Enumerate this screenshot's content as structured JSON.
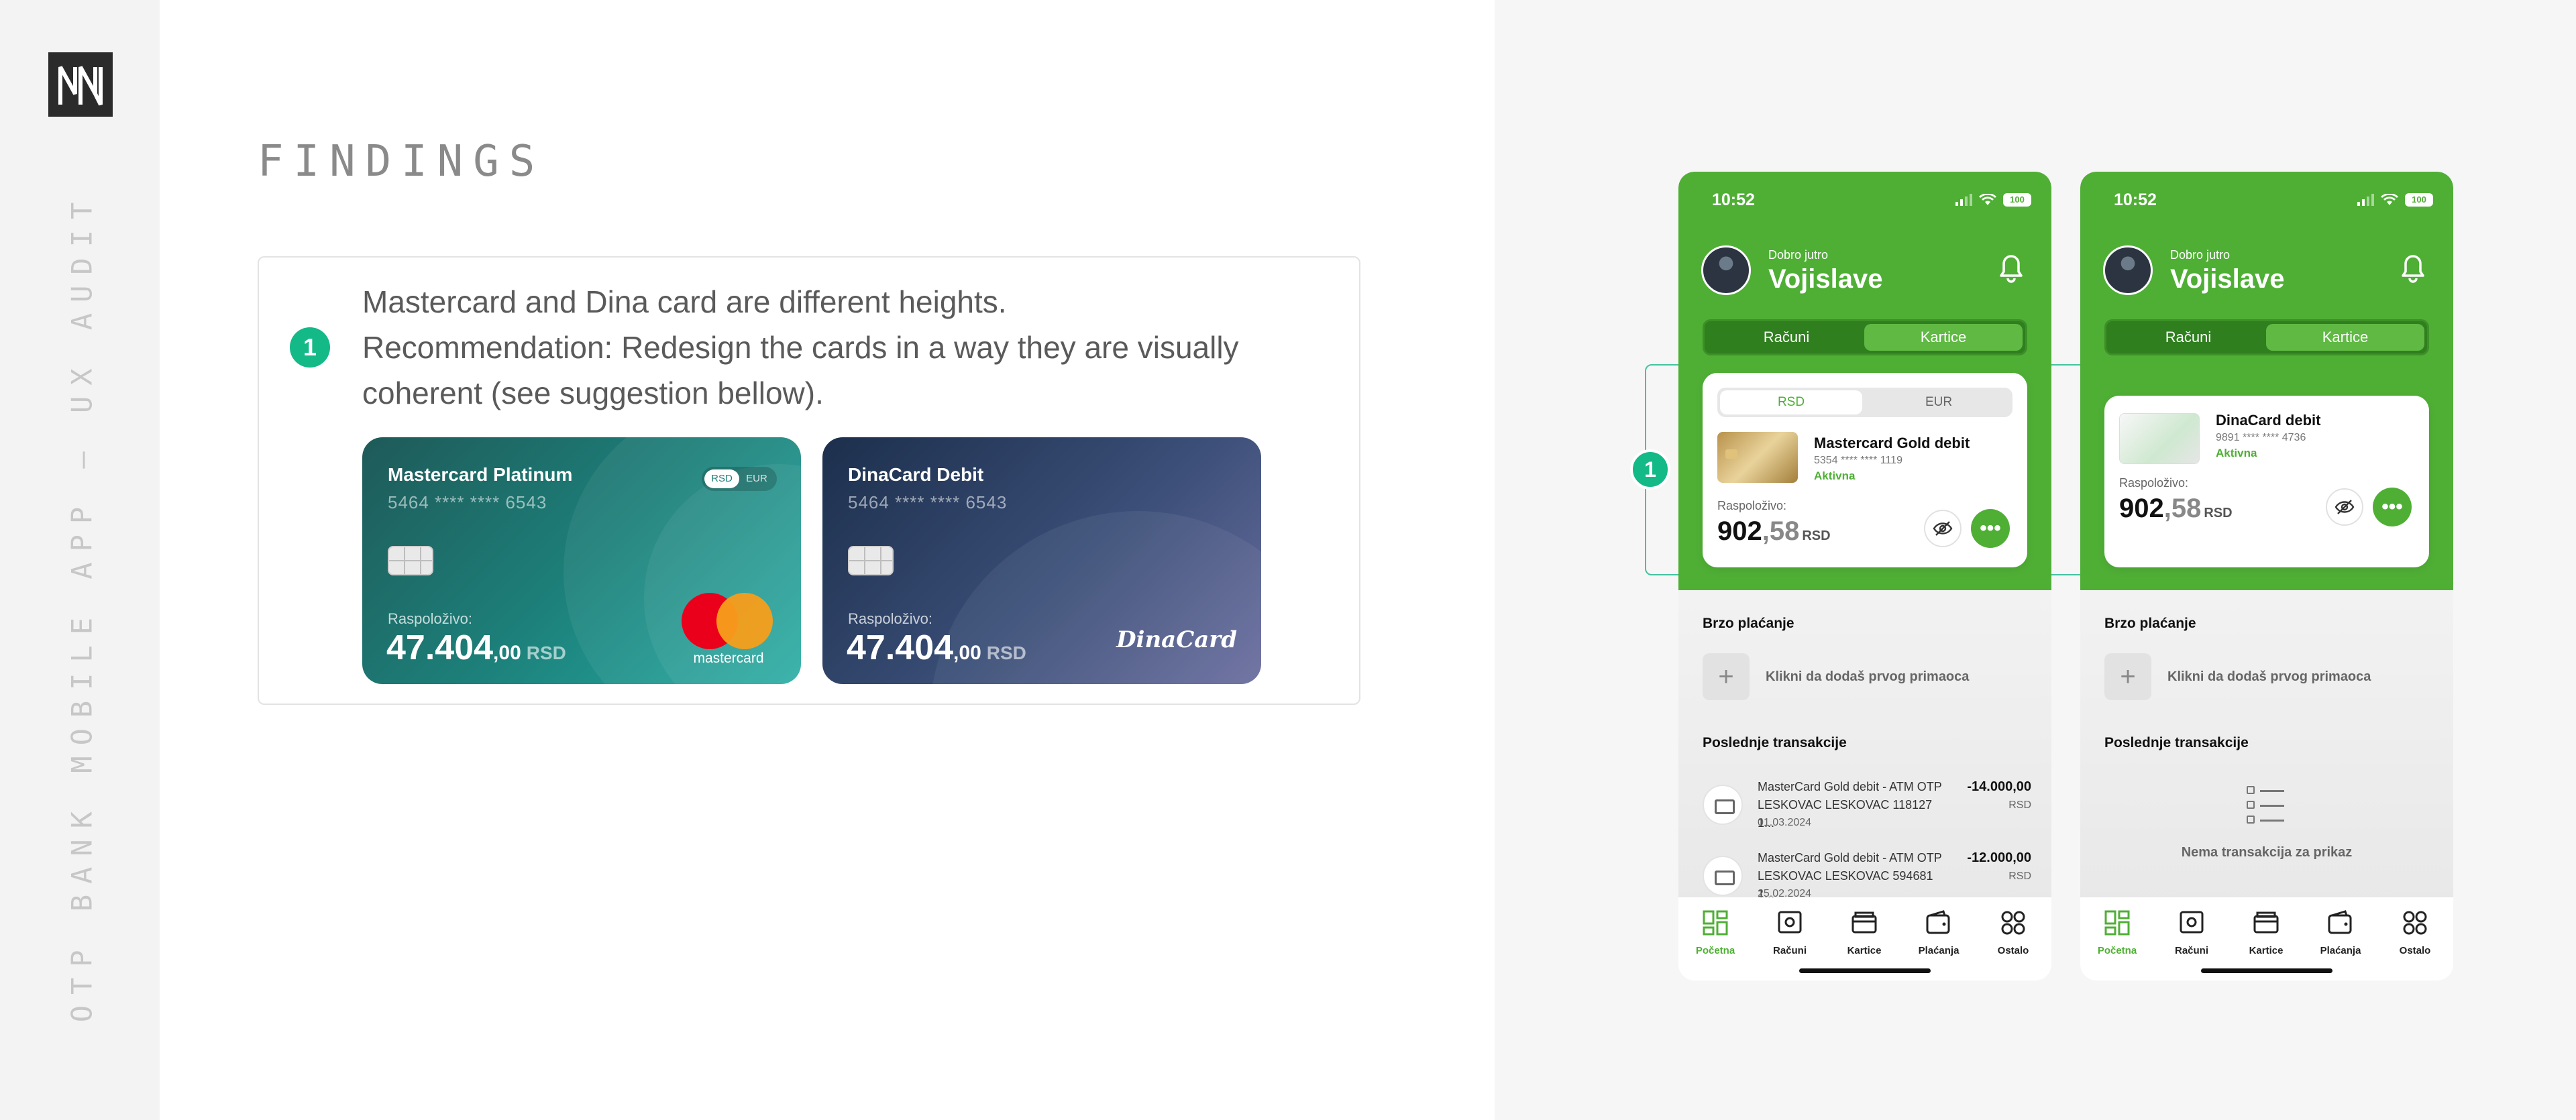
{
  "sidebar": {
    "logo_alt": "NN",
    "vertical_title": "OTP BANK MOBILE APP – UX AUDIT"
  },
  "findings": {
    "title": "FINDINGS",
    "item_number": "1",
    "text_line1": "Mastercard and Dina card are different heights.",
    "text_line2": "Recommendation: Redesign the cards in a way they are visually coherent (see suggestion bellow)."
  },
  "suggested_cards": [
    {
      "name": "Mastercard Platinum",
      "number": "5464 **** **** 6543",
      "toggle_on": "RSD",
      "toggle_off": "EUR",
      "available_label": "Raspoloživo:",
      "amount_main": "47.404",
      "amount_decimal": ",00",
      "currency": "RSD",
      "brand": "mastercard"
    },
    {
      "name": "DinaCard Debit",
      "number": "5464 **** **** 6543",
      "available_label": "Raspoloživo:",
      "amount_main": "47.404",
      "amount_decimal": ",00",
      "currency": "RSD",
      "brand": "DinaCard"
    }
  ],
  "annotation": {
    "number": "1"
  },
  "phones": [
    {
      "time": "10:52",
      "battery": "100",
      "greeting": "Dobro jutro",
      "name": "Vojislave",
      "tabs": {
        "left": "Računi",
        "right": "Kartice"
      },
      "card": {
        "toggle_on": "RSD",
        "toggle_off": "EUR",
        "title": "Mastercard Gold debit",
        "number": "5354 **** **** 1119",
        "status": "Aktivna",
        "available_label": "Raspoloživo:",
        "amount_int": "902",
        "amount_dec": ",58",
        "currency": "RSD"
      },
      "quick_pay_title": "Brzo plaćanje",
      "add_label": "Klikni da dodaš prvog primaoca",
      "transactions_title": "Poslednje transakcije",
      "transactions": [
        {
          "desc": "MasterCard Gold debit - ATM OTP LESKOVAC LESKOVAC 118127 1...",
          "date": "01.03.2024",
          "amount": "-14.000,00",
          "currency": "RSD"
        },
        {
          "desc": "MasterCard Gold debit - ATM OTP LESKOVAC LESKOVAC 594681 1...",
          "date": "25.02.2024",
          "amount": "-12.000,00",
          "currency": "RSD"
        }
      ],
      "nav": [
        "Početna",
        "Računi",
        "Kartice",
        "Plaćanja",
        "Ostalo"
      ]
    },
    {
      "time": "10:52",
      "battery": "100",
      "greeting": "Dobro jutro",
      "name": "Vojislave",
      "tabs": {
        "left": "Računi",
        "right": "Kartice"
      },
      "card": {
        "title": "DinaCard debit",
        "number": "9891 **** **** 4736",
        "status": "Aktivna",
        "available_label": "Raspoloživo:",
        "amount_int": "902",
        "amount_dec": ",58",
        "currency": "RSD"
      },
      "quick_pay_title": "Brzo plaćanje",
      "add_label": "Klikni da dodaš prvog primaoca",
      "transactions_title": "Poslednje transakcije",
      "empty_text": "Nema transakcija za prikaz",
      "nav": [
        "Početna",
        "Računi",
        "Kartice",
        "Plaćanja",
        "Ostalo"
      ]
    }
  ],
  "colors": {
    "brand_green": "#4faf35",
    "accent_teal": "#13b987",
    "mastercard_red": "#eb001b",
    "mastercard_orange": "#f79e1b"
  }
}
